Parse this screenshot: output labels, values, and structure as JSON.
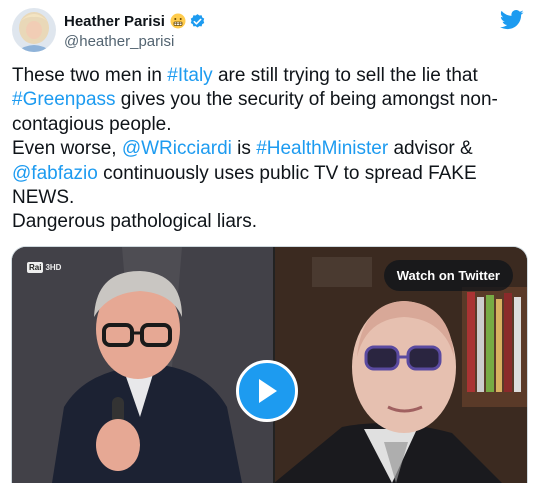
{
  "header": {
    "display_name": "Heather Parisi",
    "handle": "@heather_parisi"
  },
  "tweet": {
    "lines": [
      [
        {
          "t": "These two men in "
        },
        {
          "t": "#Italy",
          "link": true
        },
        {
          "t": " are still trying to sell the lie that"
        }
      ],
      [
        {
          "t": "#Greenpass",
          "link": true
        },
        {
          "t": " gives you the security of being amongst non-"
        }
      ],
      [
        {
          "t": "contagious people."
        }
      ],
      [
        {
          "t": "Even worse, "
        },
        {
          "t": "@WRicciardi",
          "link": true
        },
        {
          "t": " is "
        },
        {
          "t": "#HealthMinister",
          "link": true
        },
        {
          "t": " advisor &"
        }
      ],
      [
        {
          "t": "@fabfazio",
          "link": true
        },
        {
          "t": " continuously uses public TV to spread FAKE"
        }
      ],
      [
        {
          "t": "NEWS."
        }
      ],
      [
        {
          "t": "Dangerous pathological liars."
        }
      ]
    ]
  },
  "media": {
    "watch_label": "Watch on Twitter",
    "logo_text": "Rai",
    "logo_sub": "3HD"
  },
  "colors": {
    "link": "#1d9bf0",
    "text": "#0f1419",
    "secondary": "#536471"
  },
  "icons": [
    "avatar",
    "grimace-emoji-icon",
    "verified-badge-icon",
    "twitter-bird-icon",
    "play-icon"
  ]
}
